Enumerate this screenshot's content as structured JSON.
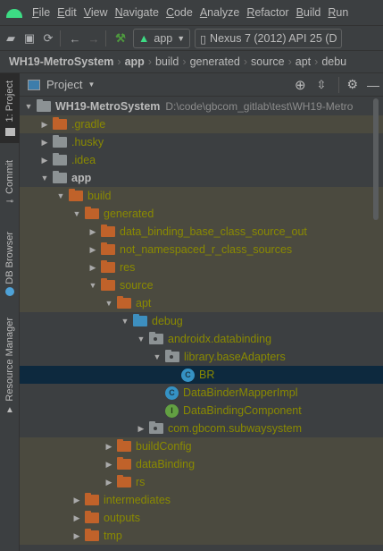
{
  "menu": [
    "File",
    "Edit",
    "View",
    "Navigate",
    "Code",
    "Analyze",
    "Refactor",
    "Build",
    "Run"
  ],
  "toolbar": {
    "config": "app",
    "device": "Nexus 7 (2012) API 25 (D"
  },
  "breadcrumb": [
    "WH19-MetroSystem",
    "app",
    "build",
    "generated",
    "source",
    "apt",
    "debu"
  ],
  "side_tabs": [
    "1: Project",
    "Commit",
    "DB Browser",
    "Resource Manager"
  ],
  "panel": {
    "title": "Project"
  },
  "tree": {
    "root": {
      "name": "WH19-MetroSystem",
      "path": "D:\\code\\gbcom_gitlab\\test\\WH19-Metro"
    },
    "rows": [
      {
        "name": ".gradle"
      },
      {
        "name": ".husky"
      },
      {
        "name": ".idea"
      },
      {
        "name": "app"
      },
      {
        "name": "build"
      },
      {
        "name": "generated"
      },
      {
        "name": "data_binding_base_class_source_out"
      },
      {
        "name": "not_namespaced_r_class_sources"
      },
      {
        "name": "res"
      },
      {
        "name": "source"
      },
      {
        "name": "apt"
      },
      {
        "name": "debug"
      },
      {
        "name": "androidx.databinding"
      },
      {
        "name": "library.baseAdapters"
      },
      {
        "name": "BR"
      },
      {
        "name": "DataBinderMapperImpl"
      },
      {
        "name": "DataBindingComponent"
      },
      {
        "name": "com.gbcom.subwaysystem"
      },
      {
        "name": "buildConfig"
      },
      {
        "name": "dataBinding"
      },
      {
        "name": "rs"
      },
      {
        "name": "intermediates"
      },
      {
        "name": "outputs"
      },
      {
        "name": "tmp"
      }
    ]
  },
  "colors": {
    "excluded_bg": "#4b4a3f",
    "selected_bg": "#0d293e",
    "excluded_text": "#8a8a00",
    "folder_orange": "#c0622a",
    "class_blue": "#3592c4"
  }
}
